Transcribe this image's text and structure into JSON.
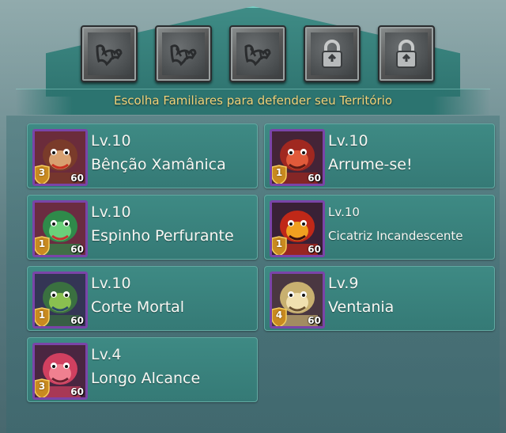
{
  "header": {
    "title": "Escolha Familiares para defender seu Território"
  },
  "slots": [
    {
      "icon": "claw-icon",
      "state": "empty"
    },
    {
      "icon": "claw-icon",
      "state": "empty"
    },
    {
      "icon": "claw-icon",
      "state": "empty"
    },
    {
      "icon": "lock-icon",
      "state": "locked"
    },
    {
      "icon": "lock-icon",
      "state": "locked"
    }
  ],
  "familiars": [
    {
      "level_label": "Lv.10",
      "skill": "Bênção Xamânica",
      "rank": "3",
      "portrait_level": "60",
      "portrait": "shaman-beast",
      "colors": [
        "#7a3b2a",
        "#d8a070",
        "#c83020"
      ]
    },
    {
      "level_label": "Lv.10",
      "skill": "Arrume-se!",
      "rank": "1",
      "portrait_level": "60",
      "portrait": "red-ogre",
      "colors": [
        "#a02820",
        "#e05a3a",
        "#5a1a14"
      ]
    },
    {
      "level_label": "Lv.10",
      "skill": "Espinho Perfurante",
      "rank": "1",
      "portrait_level": "60",
      "portrait": "cactus-beast",
      "colors": [
        "#2f8a4a",
        "#6ad07a",
        "#c83030"
      ]
    },
    {
      "level_label": "Lv.10",
      "skill": "Cicatriz Incandescente",
      "rank": "1",
      "portrait_level": "60",
      "portrait": "fire-spirit",
      "colors": [
        "#c02818",
        "#f0a020",
        "#3a1010"
      ]
    },
    {
      "level_label": "Lv.10",
      "skill": "Corte Mortal",
      "rank": "1",
      "portrait_level": "60",
      "portrait": "goblin-warrior",
      "colors": [
        "#3a7040",
        "#8ac050",
        "#2a4a6a"
      ]
    },
    {
      "level_label": "Lv.9",
      "skill": "Ventania",
      "rank": "4",
      "portrait_level": "60",
      "portrait": "griffin",
      "colors": [
        "#c8b070",
        "#f0e0b0",
        "#6a5030"
      ]
    },
    {
      "level_label": "Lv.4",
      "skill": "Longo Alcance",
      "rank": "3",
      "portrait_level": "60",
      "portrait": "pink-golem",
      "colors": [
        "#d04060",
        "#f08090",
        "#6a2030"
      ]
    }
  ]
}
